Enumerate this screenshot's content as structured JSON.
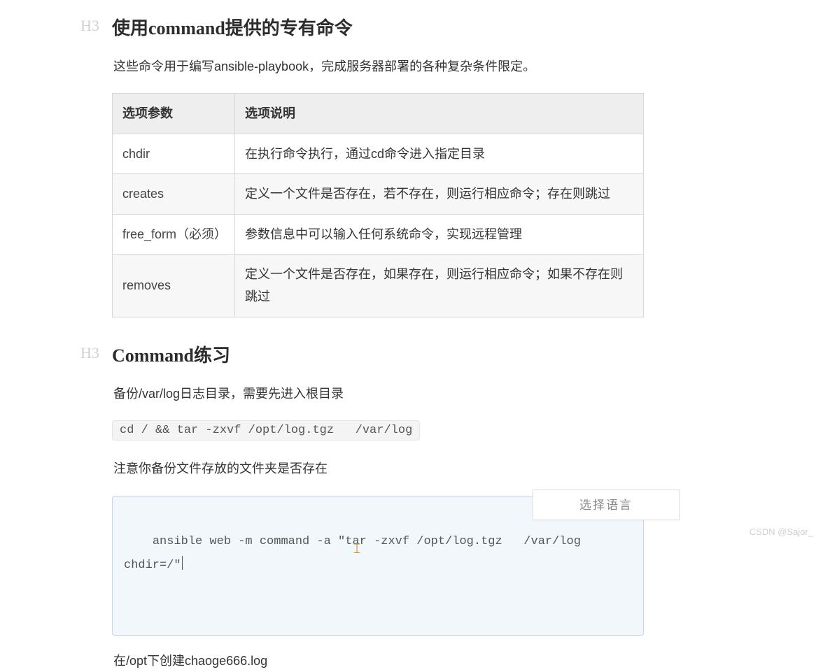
{
  "section1": {
    "h3_label": "H3",
    "title": "使用command提供的专有命令",
    "intro": "这些命令用于编写ansible-playbook，完成服务器部署的各种复杂条件限定。",
    "table": {
      "headers": [
        "选项参数",
        "选项说明"
      ],
      "rows": [
        [
          "chdir",
          "在执行命令执行，通过cd命令进入指定目录"
        ],
        [
          "creates",
          "定义一个文件是否存在，若不存在，则运行相应命令；存在则跳过"
        ],
        [
          "free_form（必须）",
          "参数信息中可以输入任何系统命令，实现远程管理"
        ],
        [
          "removes",
          "定义一个文件是否存在，如果存在，则运行相应命令；如果不存在则跳过"
        ]
      ]
    }
  },
  "section2": {
    "h3_label": "H3",
    "title": "Command练习",
    "para1": "备份/var/log日志目录，需要先进入根目录",
    "inline_code": "cd / && tar -zxvf /opt/log.tgz   /var/log",
    "para2": "注意你备份文件存放的文件夹是否存在",
    "code_block": "ansible web -m command -a \"tar -zxvf /opt/log.tgz   /var/log chdir=/\"",
    "caret_glyph": "𝙸",
    "para3": "在/opt下创建chaoge666.log"
  },
  "lang_button": "选择语言",
  "watermark": "CSDN @Sajor_"
}
